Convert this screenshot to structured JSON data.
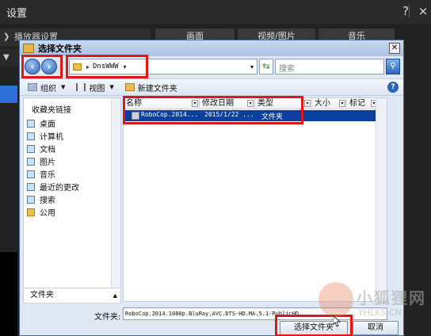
{
  "app": {
    "title": "设置",
    "help": "?",
    "close": "×"
  },
  "background": {
    "left_section": "播放器设置",
    "tabs": [
      "画面",
      "视频/图片",
      "音乐"
    ]
  },
  "dialog": {
    "title": "选择文件夹",
    "close": "✕",
    "address": "DnsWWW",
    "search_placeholder": "搜索",
    "toolbar": {
      "organize": "组织",
      "view": "视图",
      "new_folder": "新建文件夹"
    },
    "nav": {
      "header": "收藏夹链接",
      "items": [
        "桌面",
        "计算机",
        "文档",
        "图片",
        "音乐",
        "最近的更改",
        "搜索",
        "公用"
      ],
      "footer": "文件夹"
    },
    "columns": [
      "名称",
      "修改日期",
      "类型",
      "大小",
      "标记"
    ],
    "files": [
      {
        "name": "RoboCop.2014...",
        "date": "2015/1/22 ...",
        "type": "文件夹"
      }
    ],
    "filename_label": "文件夹:",
    "filename_value": "RoboCop.2014.1080p.BluRay.AVC.DTS-HD.MA.5.1-PublicHD",
    "select_button": "选择文件夹",
    "cancel_button": "取消"
  },
  "watermark": {
    "cn": "小狐狸网",
    "en": "YHLKS.CN"
  },
  "colors": {
    "highlight": "#e0161b",
    "selection": "#0b3f9e",
    "dark_bg": "#1a1a1a"
  }
}
